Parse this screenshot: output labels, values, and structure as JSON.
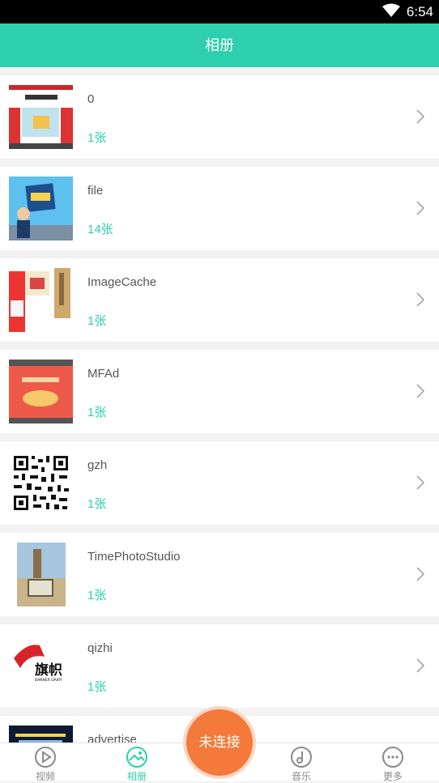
{
  "status_bar": {
    "time": "6:54"
  },
  "header": {
    "title": "相册"
  },
  "albums": [
    {
      "name": "0",
      "count": "1张"
    },
    {
      "name": "file",
      "count": "14张"
    },
    {
      "name": "ImageCache",
      "count": "1张"
    },
    {
      "name": "MFAd",
      "count": "1张"
    },
    {
      "name": "gzh",
      "count": "1张"
    },
    {
      "name": "TimePhotoStudio",
      "count": "1张"
    },
    {
      "name": "qizhi",
      "count": "1张"
    },
    {
      "name": "advertise",
      "count": ""
    }
  ],
  "thumb_text": {
    "qizhi_logo": "旗帜",
    "qizhi_sub": "BANNER DAIRY"
  },
  "tabs": [
    {
      "label": "视频",
      "icon": "play-circle-icon"
    },
    {
      "label": "相册",
      "icon": "image-icon",
      "active": true
    },
    {
      "label": "音乐",
      "icon": "music-note-icon"
    },
    {
      "label": "更多",
      "icon": "more-icon"
    }
  ],
  "connect_button": {
    "label": "未连接"
  },
  "colors": {
    "accent": "#2dcfac",
    "connect": "#f37a3a"
  }
}
